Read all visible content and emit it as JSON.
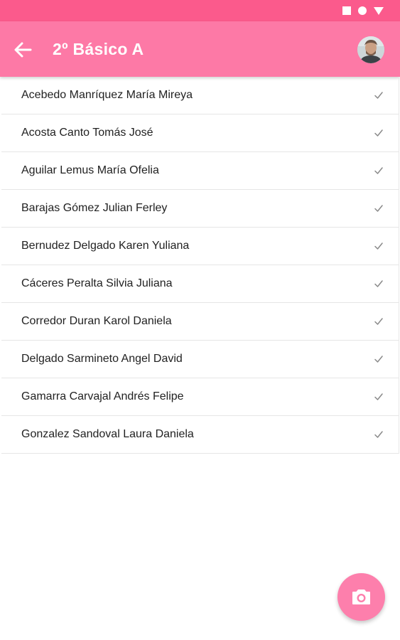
{
  "colors": {
    "status_bar": "#fb5a8c",
    "app_bar": "#fd79a6",
    "fab": "#fd7fac",
    "divider": "#e6e6e6",
    "text": "#222222"
  },
  "status_bar": {
    "icons": [
      "square-icon",
      "circle-icon",
      "triangle-icon"
    ]
  },
  "app_bar": {
    "back_icon": "arrow-left-icon",
    "title": "2º Básico A",
    "avatar_icon": "user-avatar"
  },
  "students": [
    {
      "name": "Acebedo Manríquez María Mireya",
      "icon": "check-icon"
    },
    {
      "name": "Acosta Canto Tomás José",
      "icon": "check-icon"
    },
    {
      "name": "Aguilar Lemus María Ofelia",
      "icon": "check-icon"
    },
    {
      "name": "Barajas Gómez Julian Ferley",
      "icon": "check-icon"
    },
    {
      "name": "Bernudez Delgado Karen Yuliana",
      "icon": "check-icon"
    },
    {
      "name": "Cáceres Peralta Silvia Juliana",
      "icon": "check-icon"
    },
    {
      "name": "Corredor Duran Karol Daniela",
      "icon": "check-icon"
    },
    {
      "name": "Delgado Sarmineto Angel David",
      "icon": "check-icon"
    },
    {
      "name": "Gamarra Carvajal Andrés Felipe",
      "icon": "check-icon"
    },
    {
      "name": "Gonzalez Sandoval Laura Daniela",
      "icon": "check-icon"
    }
  ],
  "fab": {
    "icon": "camera-icon"
  }
}
